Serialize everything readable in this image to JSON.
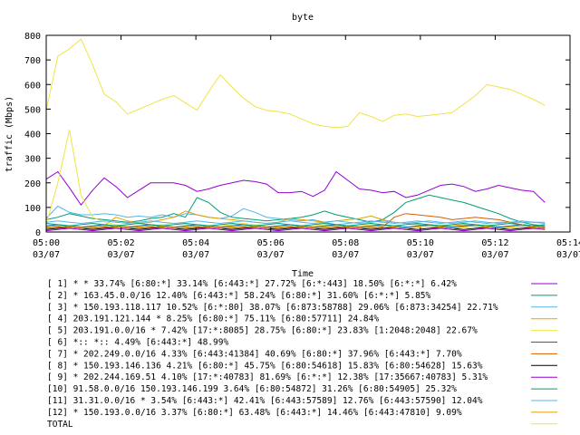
{
  "chart_data": {
    "type": "line",
    "title": "byte",
    "xlabel": "Time",
    "ylabel": "traffic (Mbps)",
    "ylim": [
      0,
      800
    ],
    "y_ticks": [
      "0",
      "100",
      "200",
      "300",
      "400",
      "500",
      "600",
      "700",
      "800"
    ],
    "x_ticks": [
      {
        "time": "05:00",
        "date": "03/07"
      },
      {
        "time": "05:02",
        "date": "03/07"
      },
      {
        "time": "05:04",
        "date": "03/07"
      },
      {
        "time": "05:06",
        "date": "03/07"
      },
      {
        "time": "05:08",
        "date": "03/07"
      },
      {
        "time": "05:10",
        "date": "03/07"
      },
      {
        "time": "05:12",
        "date": "03/07"
      },
      {
        "time": "05:14",
        "date": "03/07"
      }
    ],
    "x_minutes": [
      0,
      0.33,
      0.67,
      1,
      1.33,
      1.67,
      2,
      2.33,
      2.67,
      3,
      3.33,
      3.67,
      4,
      4.33,
      4.67,
      5,
      5.33,
      5.67,
      6,
      6.33,
      6.67,
      7,
      7.33,
      7.67,
      8,
      8.33,
      8.67,
      9,
      9.33,
      9.67,
      10,
      10.33,
      10.67,
      11,
      11.33,
      11.67,
      12,
      12.33,
      12.67,
      13,
      13.33
    ],
    "series": [
      {
        "name": "[ 1] * * 33.74%  [6:80:*] 33.14% [6:443:*] 27.72% [6:*:443] 18.50% [6:*:*] 6.42%",
        "color": "#9400d3",
        "values": [
          215,
          245,
          180,
          110,
          170,
          220,
          185,
          140,
          170,
          200,
          200,
          200,
          190,
          165,
          175,
          190,
          200,
          210,
          205,
          195,
          160,
          160,
          165,
          145,
          170,
          245,
          210,
          175,
          170,
          160,
          165,
          140,
          150,
          170,
          190,
          195,
          185,
          165,
          175,
          190,
          180,
          170,
          165,
          120
        ]
      },
      {
        "name": "[ 2] * 163.45.0.0/16 12.40%  [6:443:*] 58.24% [6:80:*] 31.60% [6:*:*] 5.85%",
        "color": "#009e73",
        "values": [
          50,
          60,
          75,
          65,
          55,
          50,
          45,
          40,
          45,
          55,
          60,
          75,
          60,
          140,
          120,
          80,
          60,
          55,
          50,
          45,
          50,
          55,
          60,
          70,
          85,
          70,
          60,
          50,
          40,
          50,
          80,
          120,
          135,
          150,
          140,
          130,
          120,
          105,
          90,
          75,
          55,
          40,
          30,
          25
        ]
      },
      {
        "name": "[ 3] * 150.193.118.117 10.52%  [6:*:80] 38.07% [6:873:58788] 29.06% [6:873:34254] 22.71%",
        "color": "#56b4e9",
        "values": [
          55,
          105,
          80,
          70,
          70,
          75,
          70,
          60,
          65,
          60,
          70,
          60,
          75,
          70,
          60,
          55,
          65,
          95,
          80,
          60,
          55,
          50,
          45,
          50,
          40,
          30,
          35,
          40,
          45,
          40,
          35,
          40,
          45,
          40,
          35,
          40,
          45,
          40,
          35,
          40,
          40,
          40,
          40,
          40
        ]
      },
      {
        "name": "[ 4] 203.191.121.144 * 8.25%  [6:80:*] 75.11% [6:80:57711] 24.84%",
        "color": "#e69f00",
        "values": [
          20,
          25,
          20,
          15,
          20,
          25,
          60,
          45,
          35,
          40,
          50,
          60,
          85,
          70,
          60,
          55,
          50,
          45,
          40,
          35,
          40,
          55,
          50,
          45,
          40,
          45,
          50,
          55,
          65,
          50,
          40,
          35,
          30,
          25,
          20,
          25,
          30,
          25,
          20,
          15,
          20,
          25,
          20,
          15
        ]
      },
      {
        "name": "[ 5] 203.191.0.0/16 * 7.42%  [17:*:8085] 28.75% [6:80:*] 23.83% [1:2048:2048] 22.67%",
        "color": "#f0e442",
        "values": [
          30,
          200,
          415,
          150,
          60,
          40,
          30,
          25,
          20,
          25,
          30,
          35,
          30,
          25,
          20,
          25,
          30,
          35,
          30,
          25,
          20,
          15,
          20,
          25,
          30,
          25,
          20,
          25,
          30,
          25,
          20,
          15,
          20,
          25,
          30,
          25,
          20,
          25,
          30,
          25,
          20,
          15,
          10,
          15
        ]
      },
      {
        "name": "[ 6] *:: *:: 4.49%  [6:443:*] 48.99%",
        "color": "#0072b2",
        "values": [
          25,
          30,
          25,
          20,
          25,
          30,
          25,
          20,
          25,
          30,
          25,
          20,
          25,
          30,
          25,
          20,
          25,
          30,
          25,
          20,
          25,
          30,
          25,
          20,
          25,
          30,
          25,
          20,
          25,
          30,
          25,
          20,
          25,
          30,
          25,
          20,
          25,
          30,
          25,
          20,
          25,
          30,
          25,
          20
        ]
      },
      {
        "name": "[ 7] * 202.249.0.0/16 4.33%  [6:443:41384] 40.69% [6:80:*] 37.96% [6:443:*] 7.70%",
        "color": "#d55e00",
        "values": [
          15,
          20,
          25,
          20,
          15,
          20,
          25,
          20,
          15,
          20,
          25,
          20,
          15,
          20,
          25,
          20,
          15,
          20,
          25,
          20,
          15,
          20,
          25,
          20,
          15,
          20,
          25,
          20,
          15,
          20,
          60,
          75,
          70,
          65,
          60,
          50,
          55,
          60,
          55,
          50,
          40,
          30,
          25,
          20
        ]
      },
      {
        "name": "[ 8] * 150.193.146.136 4.21%  [6:80:*] 45.75% [6:80:54618] 15.83% [6:80:54628] 15.63%",
        "color": "#000000",
        "values": [
          10,
          15,
          20,
          15,
          10,
          15,
          20,
          15,
          10,
          15,
          20,
          15,
          10,
          15,
          20,
          15,
          10,
          15,
          20,
          15,
          10,
          15,
          20,
          15,
          10,
          15,
          20,
          15,
          10,
          15,
          20,
          15,
          10,
          15,
          20,
          15,
          10,
          15,
          20,
          15,
          10,
          15,
          20,
          15
        ]
      },
      {
        "name": "[ 9] * 202.244.169.51 4.10%  [17:*:40783] 81.69% [6:*:*] 12.38% [17:35667:40783] 5.31%",
        "color": "#9400d3",
        "values": [
          5,
          10,
          15,
          10,
          5,
          10,
          15,
          10,
          5,
          10,
          15,
          10,
          5,
          10,
          15,
          10,
          5,
          10,
          15,
          10,
          5,
          10,
          15,
          10,
          5,
          10,
          15,
          10,
          5,
          10,
          15,
          10,
          5,
          10,
          15,
          10,
          5,
          10,
          15,
          10,
          5,
          10,
          15,
          10
        ]
      },
      {
        "name": "[10] 91.58.0.0/16 150.193.146.199 3.64%  [6:80:54872] 31.26% [6:80:54905] 25.32%",
        "color": "#009e73",
        "values": [
          35,
          30,
          25,
          30,
          35,
          30,
          25,
          30,
          35,
          30,
          25,
          30,
          35,
          30,
          25,
          30,
          35,
          30,
          25,
          30,
          35,
          30,
          25,
          30,
          35,
          30,
          25,
          30,
          35,
          30,
          25,
          30,
          35,
          30,
          25,
          30,
          35,
          30,
          25,
          30,
          35,
          30,
          25,
          30
        ]
      },
      {
        "name": "[11] 31.31.0.0/16 * 3.54%  [6:443:*] 42.41% [6:443:57589] 12.76% [6:443:57590] 12.04%",
        "color": "#56b4e9",
        "values": [
          40,
          45,
          40,
          35,
          40,
          45,
          40,
          35,
          40,
          45,
          40,
          35,
          40,
          45,
          40,
          35,
          40,
          45,
          40,
          35,
          40,
          45,
          40,
          35,
          40,
          45,
          40,
          35,
          40,
          45,
          40,
          35,
          40,
          45,
          40,
          35,
          40,
          45,
          40,
          35,
          40,
          45,
          40,
          35
        ]
      },
      {
        "name": "[12] * 150.193.0.0/16 3.37%  [6:80:*] 63.48% [6:443:*] 14.46% [6:443:47810] 9.09%",
        "color": "#e69f00",
        "values": [
          20,
          25,
          20,
          15,
          20,
          25,
          20,
          15,
          20,
          25,
          20,
          15,
          20,
          25,
          20,
          15,
          20,
          25,
          20,
          15,
          20,
          25,
          20,
          15,
          20,
          25,
          20,
          15,
          20,
          25,
          20,
          15,
          20,
          25,
          20,
          15,
          20,
          25,
          20,
          15,
          20,
          25,
          20,
          15
        ]
      },
      {
        "name": "TOTAL",
        "color": "#f0e442",
        "values": [
          495,
          715,
          745,
          785,
          680,
          560,
          530,
          480,
          500,
          520,
          540,
          555,
          525,
          495,
          570,
          640,
          590,
          545,
          510,
          495,
          490,
          480,
          460,
          440,
          430,
          425,
          430,
          485,
          470,
          450,
          475,
          480,
          470,
          475,
          480,
          485,
          520,
          555,
          600,
          590,
          580,
          560,
          540,
          515
        ]
      }
    ]
  }
}
